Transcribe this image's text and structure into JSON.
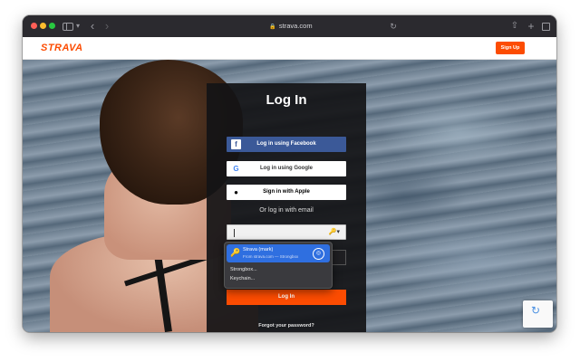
{
  "browser": {
    "url": "strava.com"
  },
  "header": {
    "logo": "STRAVA",
    "signup_label": "Sign Up"
  },
  "login": {
    "title": "Log In",
    "facebook_label": "Log in using Facebook",
    "google_label": "Log in using Google",
    "apple_label": "Sign in with Apple",
    "or_text": "Or log in with email",
    "login_label": "Log In",
    "forgot_label": "Forgot your password?"
  },
  "autofill": {
    "entry_name": "Strava (mark)",
    "entry_source": "From strava.com — Strongbox",
    "options": [
      "Strongbox...",
      "Keychain..."
    ]
  },
  "colors": {
    "brand": "#fc4c02",
    "facebook": "#3b5998",
    "autofill_highlight": "#2f6fe0"
  }
}
